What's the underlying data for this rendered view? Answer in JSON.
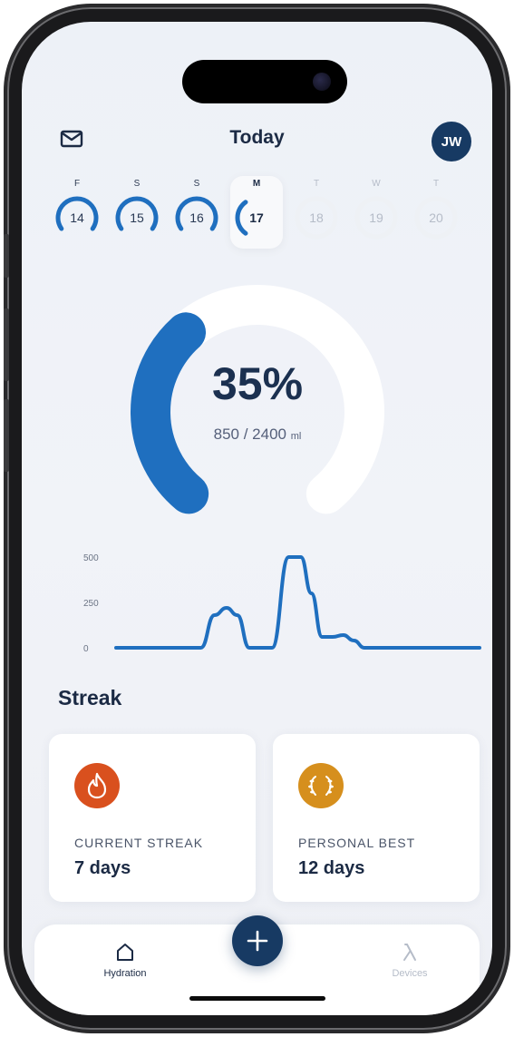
{
  "header": {
    "title": "Today",
    "avatar_initials": "JW",
    "mail_icon": "mail-icon"
  },
  "week": [
    {
      "letter": "F",
      "date": "14",
      "state": "past",
      "progress": 0.6
    },
    {
      "letter": "S",
      "date": "15",
      "state": "past",
      "progress": 0.6
    },
    {
      "letter": "S",
      "date": "16",
      "state": "past",
      "progress": 0.6
    },
    {
      "letter": "M",
      "date": "17",
      "state": "today",
      "progress": 0.35
    },
    {
      "letter": "T",
      "date": "18",
      "state": "future",
      "progress": 0
    },
    {
      "letter": "W",
      "date": "19",
      "state": "future",
      "progress": 0
    },
    {
      "letter": "T",
      "date": "20",
      "state": "future",
      "progress": 0
    }
  ],
  "progress": {
    "percent_label": "35%",
    "percent": 0.35,
    "amount": "850 / 2400",
    "unit": "ml"
  },
  "chart_data": {
    "type": "line",
    "title": "",
    "xlabel": "",
    "ylabel": "",
    "xlim": [
      0,
      24
    ],
    "ylim": [
      0,
      500
    ],
    "x_ticks": [
      "0",
      "6",
      "12",
      "18",
      "24"
    ],
    "y_ticks": [
      "0",
      "250",
      "500"
    ],
    "grid": false,
    "series": [
      {
        "x": [
          0,
          5.6,
          6.5,
          7.3,
          8.0,
          8.8,
          10.3,
          11.4,
          12.2,
          12.9,
          13.6,
          14.3,
          15.0,
          15.7,
          16.4,
          17.0,
          24
        ],
        "y": [
          0,
          0,
          180,
          220,
          180,
          0,
          0,
          500,
          500,
          300,
          60,
          60,
          70,
          40,
          0,
          0,
          0
        ]
      }
    ],
    "color": "#1f6fbf"
  },
  "streak": {
    "title": "Streak",
    "current_label": "CURRENT STREAK",
    "current_value": "7 days",
    "current_icon": "flame-icon",
    "current_color": "#d9501e",
    "best_label": "PERSONAL BEST",
    "best_value": "12 days",
    "best_icon": "laurel-icon",
    "best_color": "#d68f1d"
  },
  "tabs": [
    {
      "label": "Hydration",
      "icon": "home-icon",
      "active": true
    },
    {
      "label": "Devices",
      "icon": "lambda-icon",
      "active": false
    }
  ],
  "colors": {
    "accent": "#1f6fbf",
    "navy": "#173a63"
  }
}
